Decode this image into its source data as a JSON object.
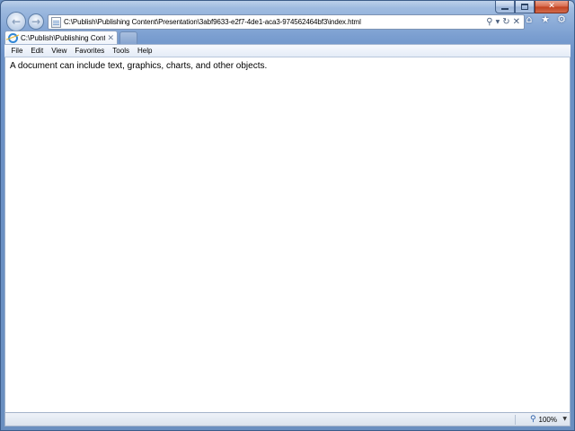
{
  "window": {
    "minimize_glyph": "",
    "maximize_glyph": "",
    "close_glyph": "✕"
  },
  "nav": {
    "back_glyph": "←",
    "forward_glyph": "→",
    "address": "C:\\Publish\\Publishing Content\\Presentation\\3abf9633-e2f7-4de1-aca3-974562464bf3\\index.html",
    "search_glyph": "⚲",
    "dropdown_glyph": "▼",
    "refresh_glyph": "↻",
    "stop_glyph": "✕",
    "home_glyph": "⌂",
    "favorites_glyph": "★",
    "tools_glyph": "⚙"
  },
  "tabs": [
    {
      "title": "C:\\Publish\\Publishing Cont...",
      "close_glyph": "✕"
    }
  ],
  "menu": [
    "File",
    "Edit",
    "View",
    "Favorites",
    "Tools",
    "Help"
  ],
  "content": {
    "text": "A document can include text, graphics, charts, and other objects."
  },
  "status": {
    "zoom": "100%",
    "zoom_dropdown_glyph": "▼"
  },
  "colors": {
    "frame": "#6a8fc0",
    "close_button": "#c2401f",
    "content_bg": "#ffffff"
  },
  "icons": [
    "back-arrow-icon",
    "forward-arrow-icon",
    "page-icon",
    "search-icon",
    "refresh-icon",
    "stop-icon",
    "home-icon",
    "favorites-star-icon",
    "tools-gear-icon",
    "ie-logo-icon",
    "zoom-icon"
  ]
}
